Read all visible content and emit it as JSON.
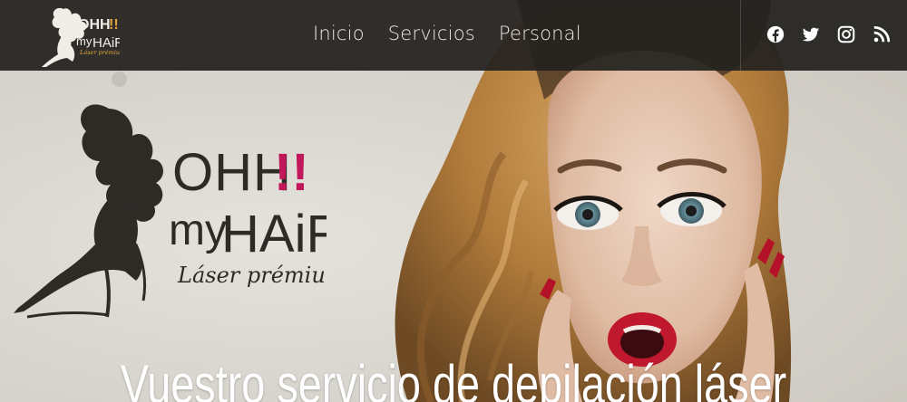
{
  "navbar": {
    "logo_alt": "OHH!! my HAIR Láser prémium",
    "links": [
      {
        "label": "Inicio"
      },
      {
        "label": "Servicios"
      },
      {
        "label": "Personal"
      }
    ],
    "social": [
      {
        "name": "facebook-icon"
      },
      {
        "name": "twitter-icon"
      },
      {
        "name": "instagram-icon"
      },
      {
        "name": "rss-icon"
      }
    ]
  },
  "brand": {
    "line1": "OHH",
    "exclaim": "!!",
    "line2_a": "my",
    "line2_b": "HAiR",
    "tagline": "Láser prémium"
  },
  "hero": {
    "headline": "Vuestro servicio de depilación láser"
  },
  "colors": {
    "navbar_bg": "#252320",
    "accent_pink": "#c2185b",
    "logo_dark": "#2e2a26",
    "nav_text": "#ece9e2"
  }
}
